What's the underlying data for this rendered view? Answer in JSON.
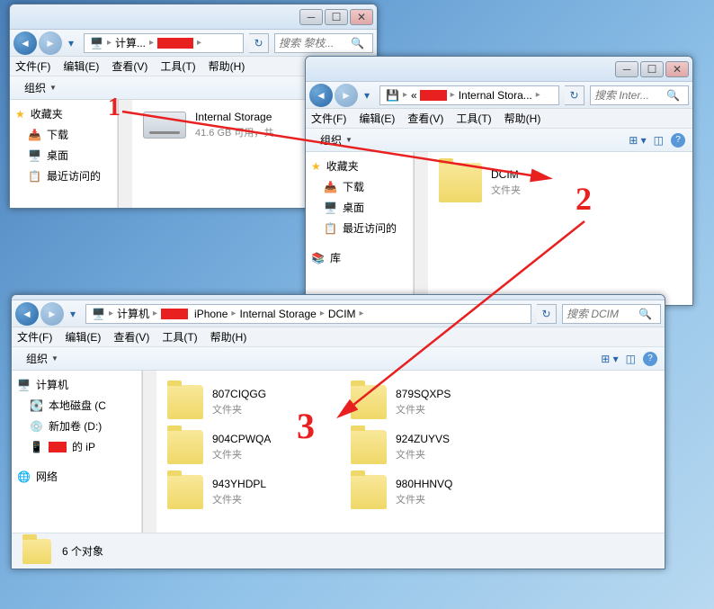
{
  "menu": {
    "file": "文件(F)",
    "edit": "编辑(E)",
    "view": "查看(V)",
    "tools": "工具(T)",
    "help": "帮助(H)"
  },
  "toolbar": {
    "organize": "组织"
  },
  "sidebar": {
    "favorites": "收藏夹",
    "downloads": "下载",
    "desktop": "桌面",
    "recent": "最近访问的",
    "libraries": "库",
    "computer": "计算机",
    "local_disk": "本地磁盘 (C",
    "new_volume": "新加卷 (D:)",
    "iphone": "的 iP",
    "network": "网络"
  },
  "window1": {
    "crumb1": "计算...",
    "search_placeholder": "搜索 黎枝...",
    "item": {
      "name": "Internal Storage",
      "sub": "41.6 GB 可用，共"
    }
  },
  "window2": {
    "crumb1": "Internal Stora...",
    "search_placeholder": "搜索 Inter...",
    "item": {
      "name": "DCIM",
      "sub": "文件夹"
    }
  },
  "window3": {
    "crumbs": [
      "计算机",
      "iPhone",
      "Internal Storage",
      "DCIM"
    ],
    "search_placeholder": "搜索 DCIM",
    "folders": [
      {
        "name": "807CIQGG",
        "sub": "文件夹"
      },
      {
        "name": "879SQXPS",
        "sub": "文件夹"
      },
      {
        "name": "904CPWQA",
        "sub": "文件夹"
      },
      {
        "name": "924ZUYVS",
        "sub": "文件夹"
      },
      {
        "name": "943YHDPL",
        "sub": "文件夹"
      },
      {
        "name": "980HHNVQ",
        "sub": "文件夹"
      }
    ],
    "status": "6 个对象"
  },
  "annotations": {
    "a1": "1",
    "a2": "2",
    "a3": "3"
  }
}
